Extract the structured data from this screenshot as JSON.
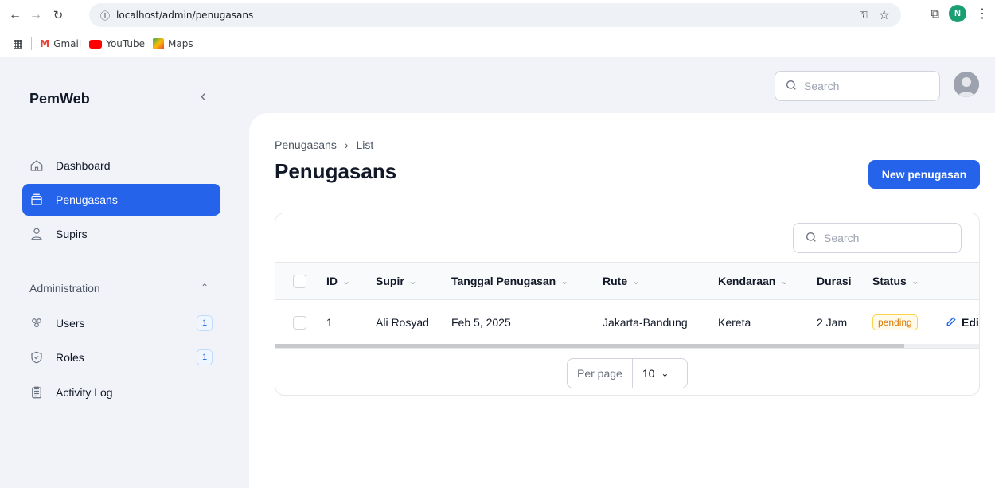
{
  "browser": {
    "url": "localhost/admin/penugasans",
    "bookmarks": [
      "Gmail",
      "YouTube",
      "Maps"
    ],
    "profile_initial": "N"
  },
  "sidebar": {
    "brand": "PemWeb",
    "items": [
      {
        "label": "Dashboard",
        "icon": "home-icon"
      },
      {
        "label": "Penugasans",
        "icon": "box-icon",
        "active": true
      },
      {
        "label": "Supirs",
        "icon": "user-icon"
      }
    ],
    "group_label": "Administration",
    "admin_items": [
      {
        "label": "Users",
        "icon": "users-icon",
        "badge": "1"
      },
      {
        "label": "Roles",
        "icon": "shield-check-icon",
        "badge": "1"
      },
      {
        "label": "Activity Log",
        "icon": "clipboard-icon"
      }
    ]
  },
  "topbar": {
    "search_placeholder": "Search"
  },
  "main": {
    "breadcrumb": [
      "Penugasans",
      "List"
    ],
    "title": "Penugasans",
    "new_button": "New penugasan",
    "table": {
      "search_placeholder": "Search",
      "columns": [
        "ID",
        "Supir",
        "Tanggal Penugasan",
        "Rute",
        "Kendaraan",
        "Durasi",
        "Status"
      ],
      "rows": [
        {
          "id": "1",
          "supir": "Ali Rosyad",
          "tanggal": "Feb 5, 2025",
          "rute": "Jakarta-Bandung",
          "kendaraan": "Kereta",
          "durasi": "2 Jam",
          "status": "pending",
          "action": "Edi"
        }
      ],
      "per_page_label": "Per page",
      "per_page_value": "10"
    }
  },
  "colors": {
    "accent": "#2563eb",
    "status_pending": "#d97706"
  }
}
